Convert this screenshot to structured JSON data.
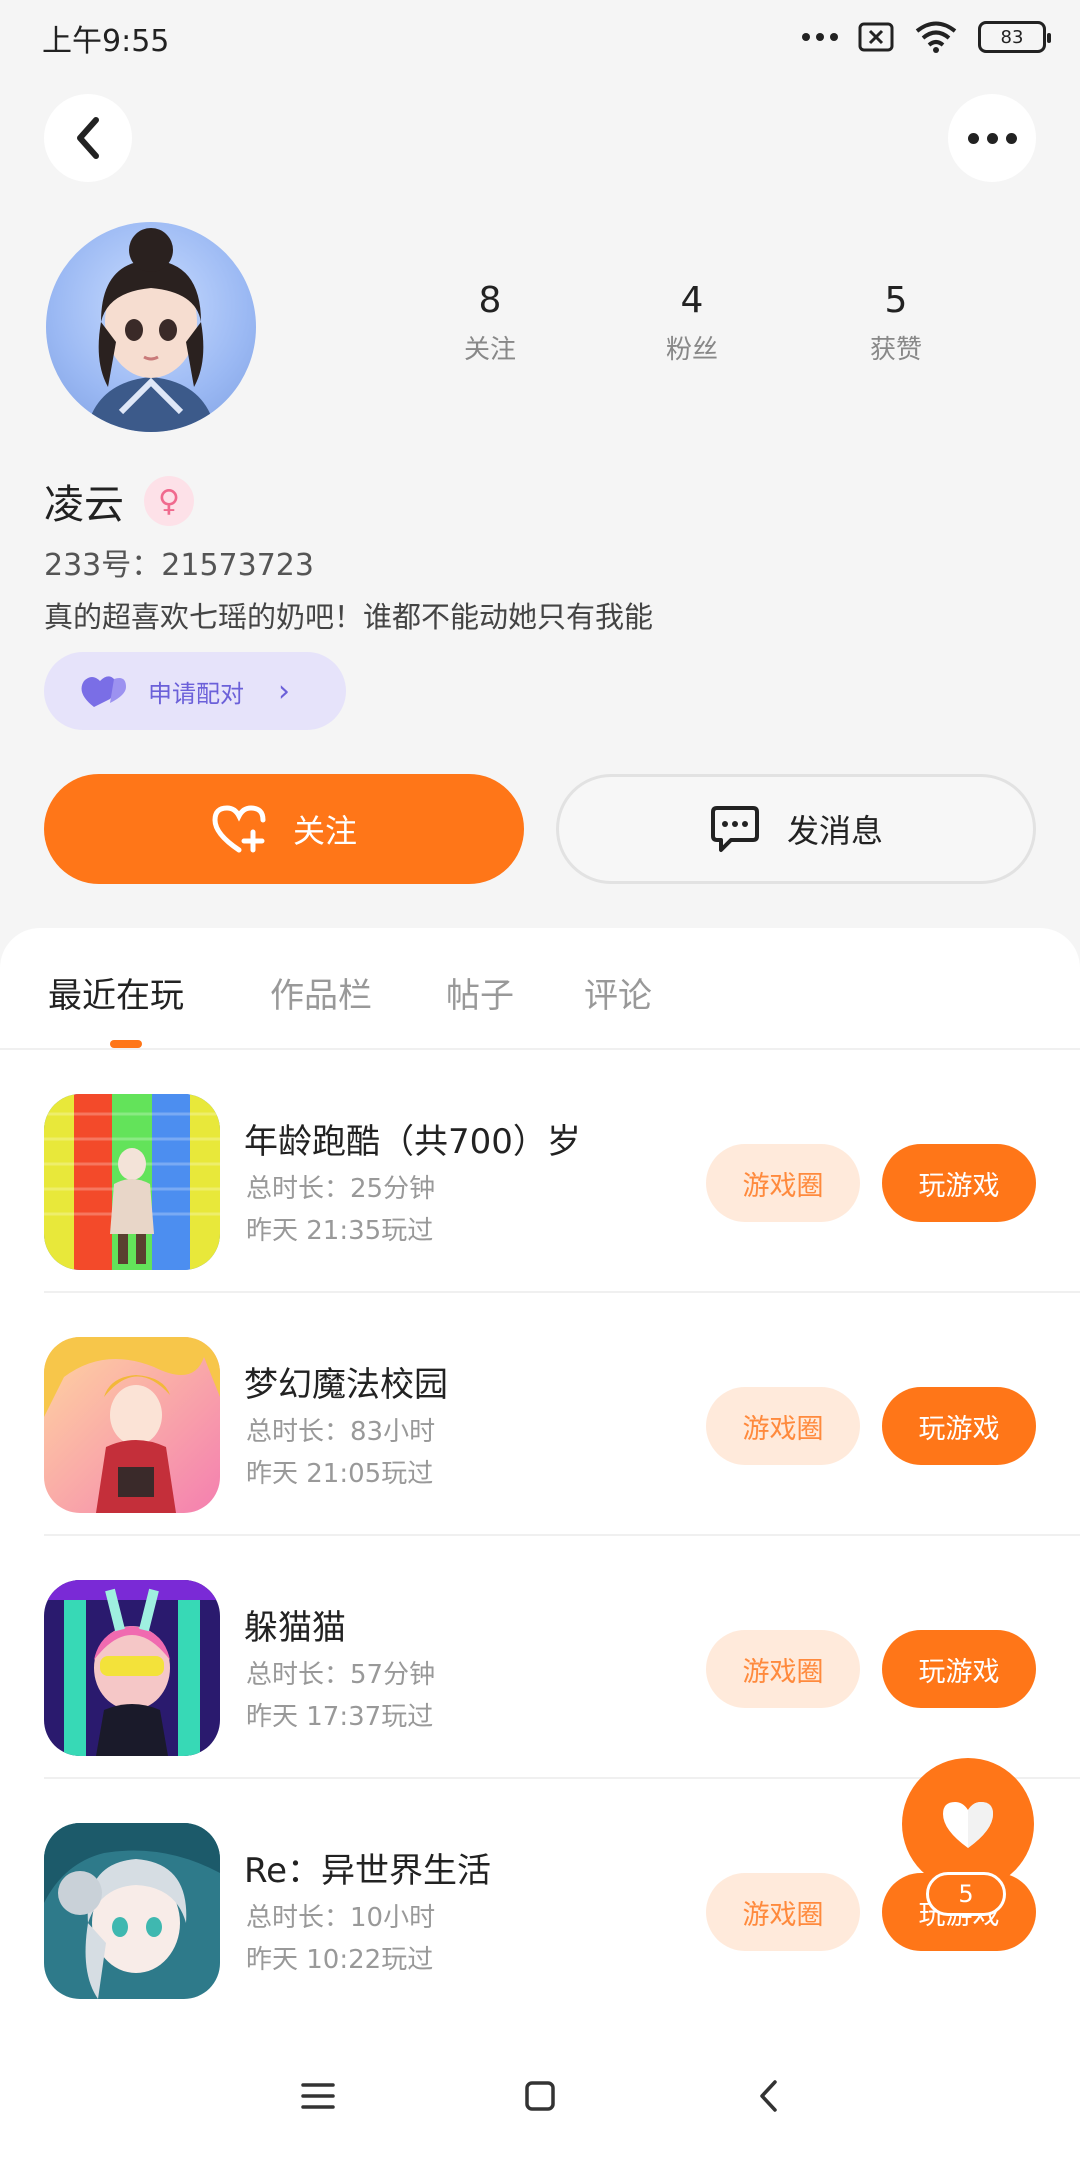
{
  "status_bar": {
    "time": "上午9:55",
    "battery": "83"
  },
  "profile": {
    "name": "凌云",
    "gender_symbol": "♀",
    "uid_label": "233号：",
    "uid": "21573723",
    "bio": "真的超喜欢七瑶的奶吧！谁都不能动她只有我能",
    "stats": [
      {
        "value": "8",
        "label": "关注"
      },
      {
        "value": "4",
        "label": "粉丝"
      },
      {
        "value": "5",
        "label": "获赞"
      }
    ],
    "pair_label": "申请配对"
  },
  "actions": {
    "follow_label": "关注",
    "message_label": "发消息"
  },
  "tabs": [
    {
      "label": "最近在玩",
      "active": true
    },
    {
      "label": "作品栏",
      "active": false
    },
    {
      "label": "帖子",
      "active": false
    },
    {
      "label": "评论",
      "active": false
    }
  ],
  "games": [
    {
      "title": "年龄跑酷（共700）岁",
      "duration": "总时长：25分钟",
      "last_played": "昨天 21:35玩过",
      "circle_label": "游戏圈",
      "play_label": "玩游戏"
    },
    {
      "title": "梦幻魔法校园",
      "duration": "总时长：83小时",
      "last_played": "昨天 21:05玩过",
      "circle_label": "游戏圈",
      "play_label": "玩游戏"
    },
    {
      "title": "躲猫猫",
      "duration": "总时长：57分钟",
      "last_played": "昨天 17:37玩过",
      "circle_label": "游戏圈",
      "play_label": "玩游戏"
    },
    {
      "title": "Re：异世界生活",
      "duration": "总时长：10小时",
      "last_played": "昨天 10:22玩过",
      "circle_label": "游戏圈",
      "play_label": "玩游戏"
    }
  ],
  "like_fab": {
    "count": "5"
  },
  "colors": {
    "accent": "#ff7618",
    "accent_light": "#ffeadb",
    "pair_bg": "#e6e3fa",
    "pair_fg": "#6b60d9"
  },
  "icons": {
    "back": "chevron-left-icon",
    "more": "more-dots-icon",
    "follow": "heart-plus-icon",
    "message": "chat-bubble-icon",
    "pair": "heart-pair-icon",
    "like": "heart-icon",
    "nav_menu": "menu-icon",
    "nav_home": "square-icon",
    "nav_back": "chevron-left-icon"
  }
}
